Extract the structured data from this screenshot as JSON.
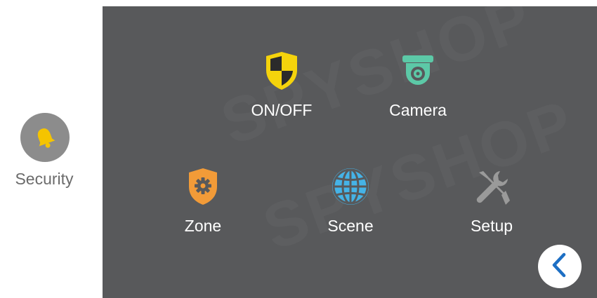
{
  "sidebar": {
    "items": [
      {
        "label": "Security",
        "icon": "bell-icon",
        "icon_color": "#f5c400",
        "circle_color": "#8c8c8c"
      }
    ]
  },
  "main": {
    "tiles": [
      {
        "label": "ON/OFF",
        "icon": "shield-checker-icon",
        "color": "#f5d30c"
      },
      {
        "label": "Camera",
        "icon": "camera-icon",
        "color": "#5cc9a7"
      },
      {
        "label": "Zone",
        "icon": "shield-gear-icon",
        "color": "#f29b38"
      },
      {
        "label": "Scene",
        "icon": "globe-icon",
        "color": "#45b3e7"
      },
      {
        "label": "Setup",
        "icon": "tools-icon",
        "color": "#9a9a9a"
      }
    ],
    "back_button": {
      "icon": "chevron-left-icon",
      "color": "#1d6fc4"
    }
  },
  "background": {
    "panel": "#58595b",
    "page": "#ffffff"
  }
}
